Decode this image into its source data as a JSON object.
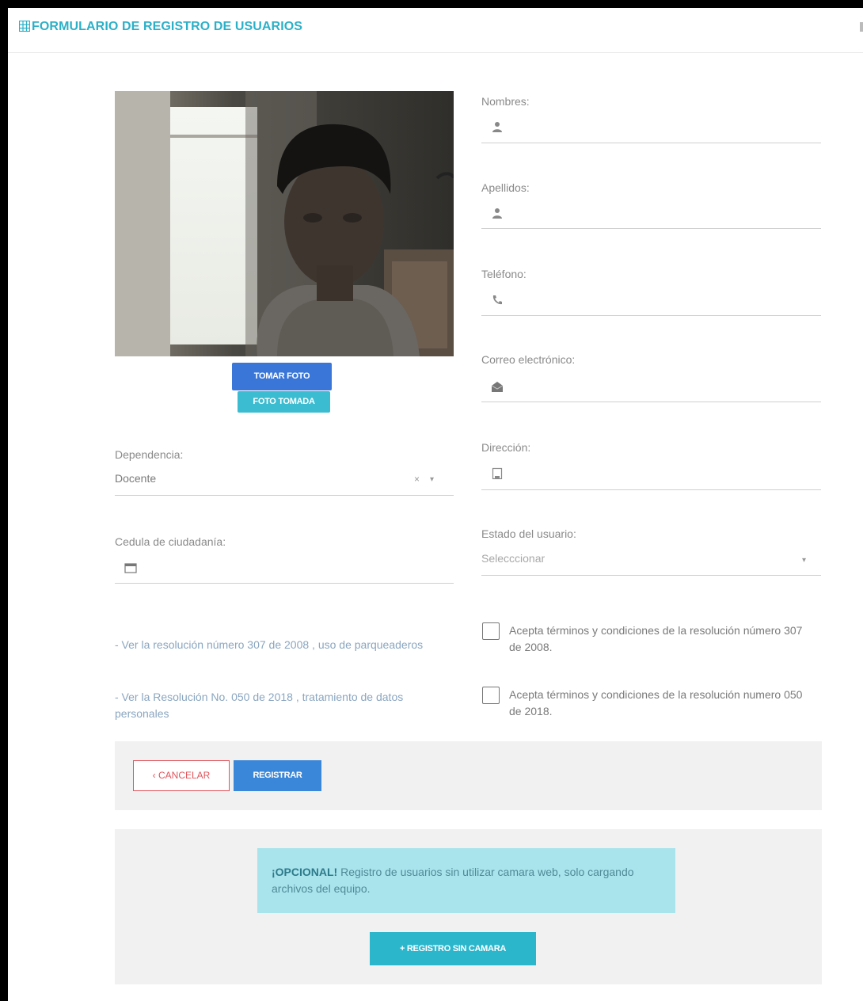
{
  "header": {
    "title": "FORMULARIO DE REGISTRO DE USUARIOS",
    "icon": "table-icon"
  },
  "camera": {
    "take_photo": "TOMAR FOTO",
    "photo_taken": "FOTO TOMADA"
  },
  "fields": {
    "nombres": {
      "label": "Nombres:",
      "icon": "user-icon",
      "value": ""
    },
    "apellidos": {
      "label": "Apellidos:",
      "icon": "user-icon",
      "value": ""
    },
    "telefono": {
      "label": "Teléfono:",
      "icon": "phone-icon",
      "value": ""
    },
    "correo": {
      "label": "Correo electrónico:",
      "icon": "envelope-icon",
      "value": ""
    },
    "direccion": {
      "label": "Dirección:",
      "icon": "building-icon",
      "value": ""
    },
    "dependencia": {
      "label": "Dependencia:",
      "value": "Docente",
      "clear": "×"
    },
    "estado": {
      "label": "Estado del usuario:",
      "placeholder": "Selecccionar"
    },
    "cedula": {
      "label": "Cedula de ciudadanía:",
      "icon": "id-card-icon",
      "value": ""
    }
  },
  "links": [
    "- Ver la resolución número 307 de 2008 , uso de parqueaderos",
    "- Ver la Resolución No. 050 de 2018 , tratamiento de datos personales"
  ],
  "checkboxes": [
    {
      "label": "Acepta términos y condiciones de la resolución número 307 de 2008.",
      "checked": false
    },
    {
      "label": "Acepta términos y condiciones de la resolución numero 050 de 2018.",
      "checked": false
    }
  ],
  "actions": {
    "cancel": "‹ CANCELAR",
    "register": "REGISTRAR"
  },
  "optional": {
    "title": "¡OPCIONAL!",
    "text": " Registro de usuarios sin utilizar camara web, solo cargando archivos del equipo.",
    "button": "+ REGISTRO SIN CAMARA"
  },
  "colors": {
    "accent": "#2bb0c8",
    "primary": "#3a76d8",
    "danger": "#e0555c",
    "info_bg": "#a9e4ed"
  }
}
